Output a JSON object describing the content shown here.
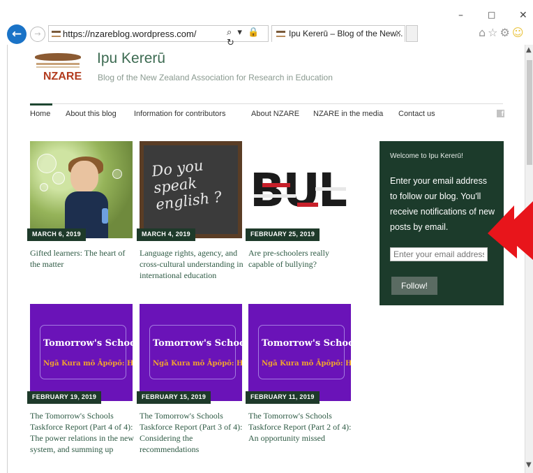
{
  "browser": {
    "address_url": "https://nzareblog.wordpress.com/",
    "tab_title": "Ipu Kererū – Blog of the New...",
    "tab_close": "×",
    "minimize": "–",
    "maximize": "□",
    "close": "✕",
    "back": "←",
    "forward": "→",
    "addr_tools": "⌕ ▾ 🔒 ↻",
    "right_icons_home": "⌂",
    "right_icons_star": "☆",
    "right_icons_gear": "⚙",
    "right_icons_smiley": "☺"
  },
  "site": {
    "logo_text": "NZARE",
    "title": "Ipu Kererū",
    "description": "Blog of the New Zealand Association for Research in Education"
  },
  "nav": {
    "items": [
      {
        "label": "Home"
      },
      {
        "label": "About this blog"
      },
      {
        "label": "Information for contributors"
      },
      {
        "label": "About NZARE"
      },
      {
        "label": "NZARE in the media"
      },
      {
        "label": "Contact us"
      }
    ],
    "social_icon": "f"
  },
  "posts": [
    {
      "date": "MARCH 6, 2019",
      "title": "Gifted learners: The heart of the matter"
    },
    {
      "date": "MARCH 4, 2019",
      "title": "Language rights, agency, and cross-cultural understanding in international education",
      "image_text": "Do you speak english ?"
    },
    {
      "date": "FEBRUARY 25, 2019",
      "title": "Are pre-schoolers really capable of bullying?",
      "image_text": "BULLY"
    },
    {
      "date": "FEBRUARY 19, 2019",
      "title": "The Tomorrow's Schools Taskforce Report (Part 4 of 4): The power relations in the new system, and summing up",
      "image_title": "Tomorrow's Schools Review",
      "image_subtitle": "Ngā Kura mō Āpōpō: He Arotake"
    },
    {
      "date": "FEBRUARY 15, 2019",
      "title": "The Tomorrow's Schools Taskforce Report (Part 3 of 4): Considering the recommendations",
      "image_title": "Tomorrow's Schools Review",
      "image_subtitle": "Ngā Kura mō Āpōpō: He Arotake"
    },
    {
      "date": "FEBRUARY 11, 2019",
      "title": "The Tomorrow's Schools Taskforce Report (Part 2 of 4): An opportunity missed",
      "image_title": "Tomorrow's Schools Review",
      "image_subtitle": "Ngā Kura mō Āpōpō: He Arotake"
    }
  ],
  "widget": {
    "title": "Welcome to Ipu Kererū!",
    "text": "Enter your email address to follow our blog. You'll receive notifications of new posts by email.",
    "input_placeholder": "Enter your email address",
    "button_label": "Follow!"
  },
  "colors": {
    "accent": "#1e4631",
    "link": "#2e5a44",
    "widget_bg": "#1c3b2b",
    "arrow": "#e8151b",
    "purple": "#6a13b8"
  }
}
